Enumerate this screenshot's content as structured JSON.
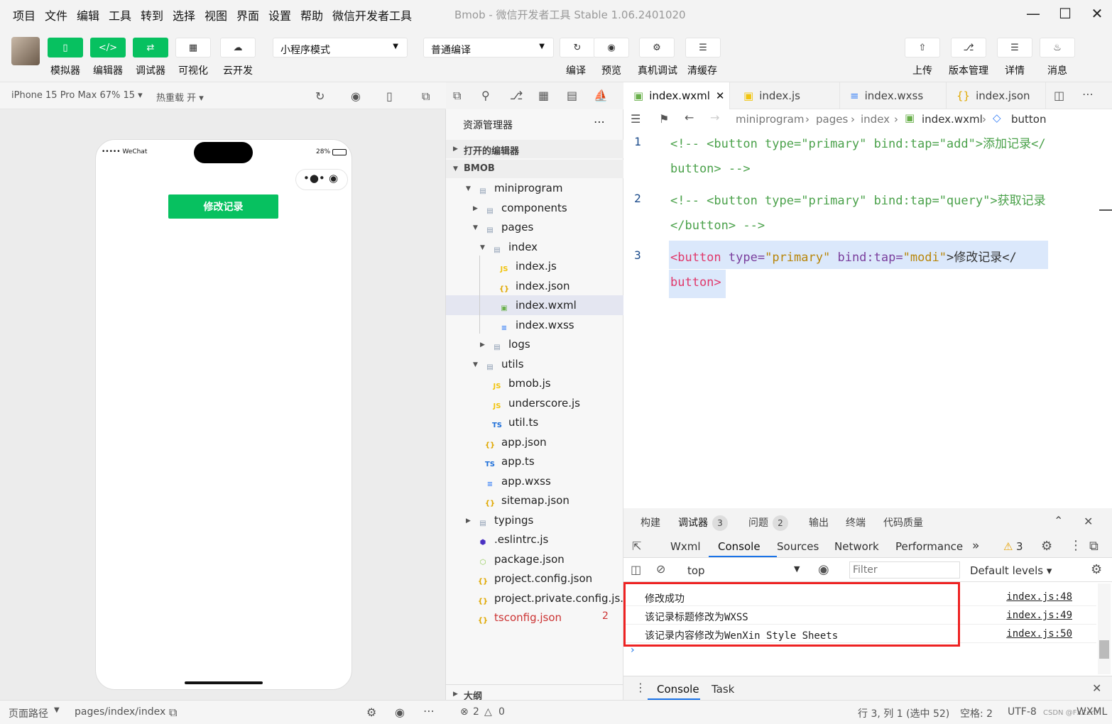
{
  "menu": {
    "items": [
      "项目",
      "文件",
      "编辑",
      "工具",
      "转到",
      "选择",
      "视图",
      "界面",
      "设置",
      "帮助",
      "微信开发者工具"
    ],
    "window_title": "Bmob - 微信开发者工具 Stable 1.06.2401020"
  },
  "toolbar": {
    "simulator": "模拟器",
    "editor": "编辑器",
    "debugger": "调试器",
    "visual": "可视化",
    "cloud": "云开发",
    "mode_select": "小程序模式",
    "compile_select": "普通编译",
    "compile": "编译",
    "preview": "预览",
    "real_debug": "真机调试",
    "clear_cache": "清缓存",
    "upload": "上传",
    "version": "版本管理",
    "details": "详情",
    "messages": "消息"
  },
  "simulator": {
    "device": "iPhone 15 Pro Max 67% 15",
    "hot_reload": "热重载 开",
    "carrier": "••••• WeChat",
    "battery": "28%",
    "button_label": "修改记录",
    "page_path_label": "页面路径",
    "page_path": "pages/index/index"
  },
  "explorer": {
    "title": "资源管理器",
    "open_editors": "打开的编辑器",
    "project": "BMOB",
    "outline": "大纲",
    "items": [
      {
        "name": "miniprogram",
        "type": "folder"
      },
      {
        "name": "components",
        "type": "folder"
      },
      {
        "name": "pages",
        "type": "folder"
      },
      {
        "name": "index",
        "type": "folder"
      },
      {
        "name": "index.js",
        "type": "js"
      },
      {
        "name": "index.json",
        "type": "json"
      },
      {
        "name": "index.wxml",
        "type": "wxml"
      },
      {
        "name": "index.wxss",
        "type": "wxss"
      },
      {
        "name": "logs",
        "type": "folder"
      },
      {
        "name": "utils",
        "type": "folder"
      },
      {
        "name": "bmob.js",
        "type": "js"
      },
      {
        "name": "underscore.js",
        "type": "js"
      },
      {
        "name": "util.ts",
        "type": "ts"
      },
      {
        "name": "app.json",
        "type": "json"
      },
      {
        "name": "app.ts",
        "type": "ts"
      },
      {
        "name": "app.wxss",
        "type": "wxss"
      },
      {
        "name": "sitemap.json",
        "type": "json"
      },
      {
        "name": "typings",
        "type": "folder"
      },
      {
        "name": ".eslintrc.js",
        "type": "eslint"
      },
      {
        "name": "package.json",
        "type": "node"
      },
      {
        "name": "project.config.json",
        "type": "json"
      },
      {
        "name": "project.private.config.js...",
        "type": "json"
      },
      {
        "name": "tsconfig.json",
        "type": "json"
      }
    ],
    "tsconfig_errors": "2"
  },
  "editor": {
    "tabs": [
      "index.wxml",
      "index.js",
      "index.wxss",
      "index.json"
    ],
    "breadcrumb": [
      "miniprogram",
      "pages",
      "index",
      "index.wxml",
      "button"
    ],
    "line_numbers": [
      "1",
      "2",
      "3"
    ],
    "line1a": "<!-- <button type=\"primary\" bind:tap=\"add\">添加记录</",
    "line1b": "button> -->",
    "line2a": "<!-- <button type=\"primary\" bind:tap=\"query\">获取记录",
    "line2b": "</button> -->",
    "line3": {
      "open": "<button",
      "attr1": "type=",
      "val1": "\"primary\"",
      "attr2": "bind:tap=",
      "val2": "\"modi\"",
      "text": ">修改记录</",
      "close": "button>"
    }
  },
  "devtools": {
    "top_tabs": [
      "构建",
      "调试器",
      "问题",
      "输出",
      "终端",
      "代码质量"
    ],
    "debugger_badge": "3",
    "issues_badge": "2",
    "panel_tabs": [
      "Wxml",
      "Console",
      "Sources",
      "Network",
      "Performance"
    ],
    "warnings": "3",
    "context": "top",
    "filter_placeholder": "Filter",
    "levels": "Default levels",
    "logs": [
      {
        "msg": "修改成功",
        "src": "index.js:48"
      },
      {
        "msg": "该记录标题修改为WXSS",
        "src": "index.js:49"
      },
      {
        "msg": "该记录内容修改为WenXin Style Sheets",
        "src": "index.js:50"
      }
    ],
    "drawer_tabs": [
      "Console",
      "Task"
    ]
  },
  "status": {
    "errors": "2",
    "warnings": "0",
    "position": "行 3, 列 1 (选中 52)",
    "spaces": "空格: 2",
    "encoding": "UTF-8",
    "lang": "WXML",
    "watermark": "CSDN @FXZer0"
  }
}
